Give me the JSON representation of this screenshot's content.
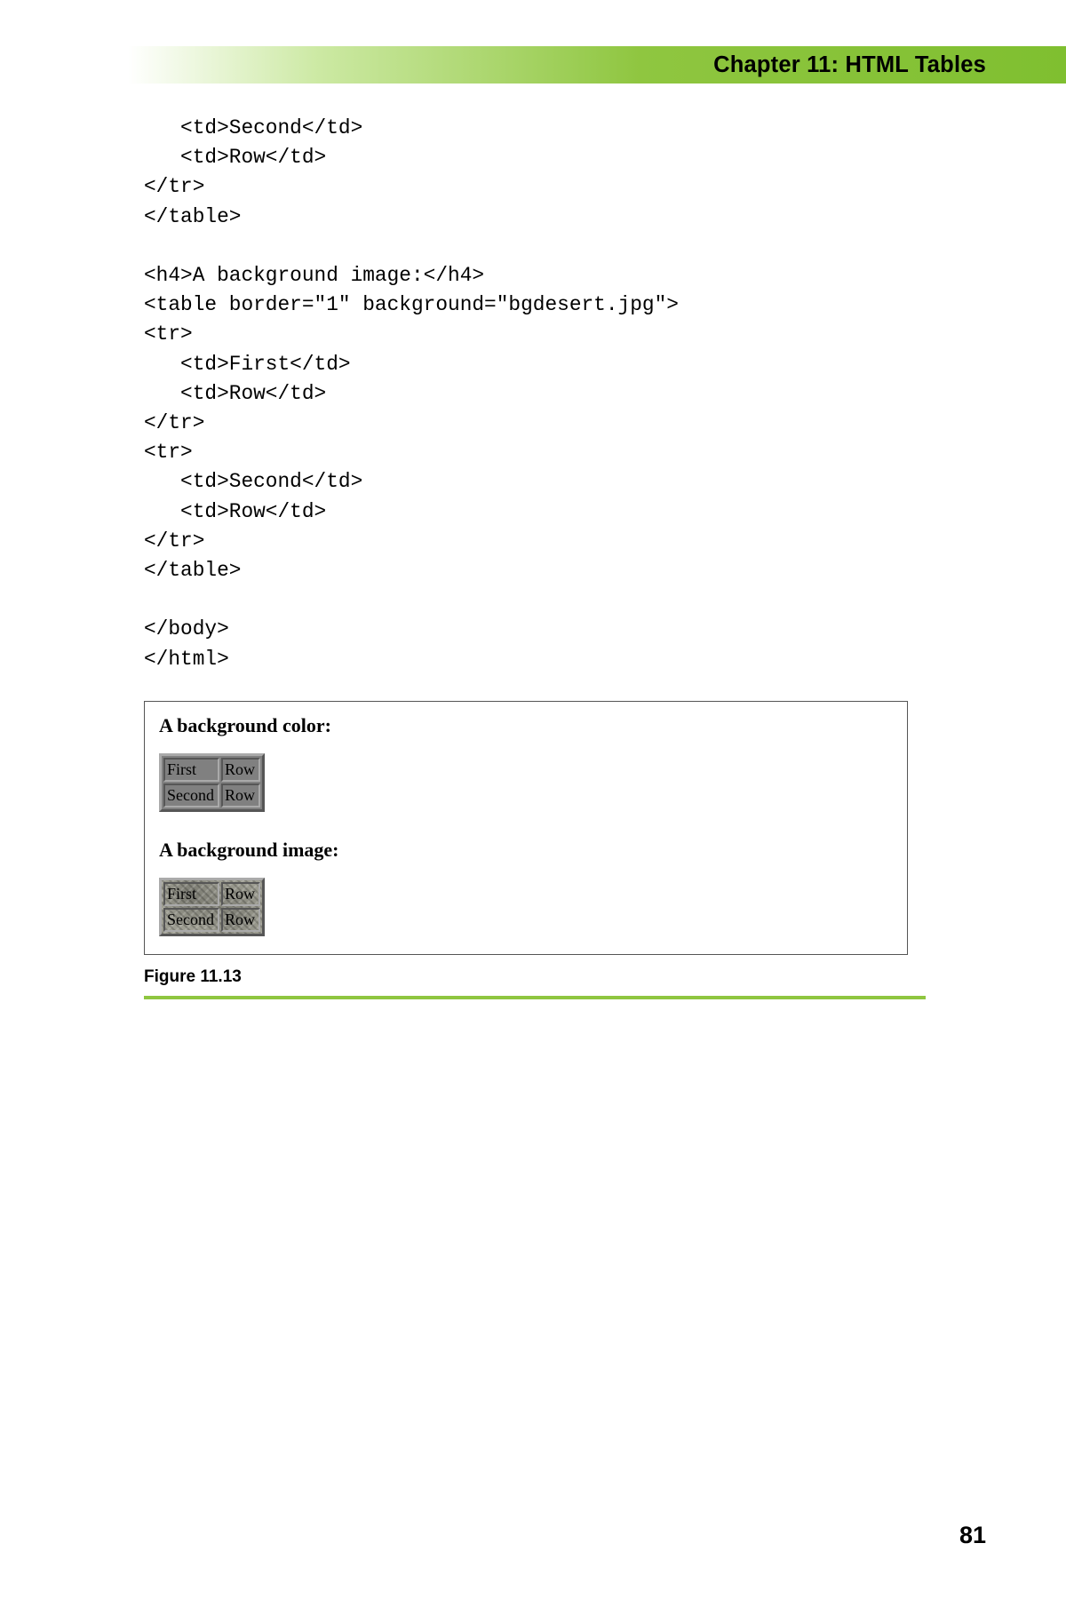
{
  "header": {
    "chapter_title": "Chapter 11: HTML Tables"
  },
  "code": {
    "body": "   <td>Second</td>\n   <td>Row</td>\n</tr>\n</table>\n\n<h4>A background image:</h4>\n<table border=\"1\" background=\"bgdesert.jpg\">\n<tr>\n   <td>First</td>\n   <td>Row</td>\n</tr>\n<tr>\n   <td>Second</td>\n   <td>Row</td>\n</tr>\n</table>\n\n</body>\n</html>"
  },
  "rendered": {
    "heading_color": "A background color:",
    "heading_image": "A background image:",
    "rows": [
      {
        "c1": "First",
        "c2": "Row"
      },
      {
        "c1": "Second",
        "c2": "Row"
      }
    ]
  },
  "figure": {
    "caption": "Figure 11.13"
  },
  "page_number": "81"
}
